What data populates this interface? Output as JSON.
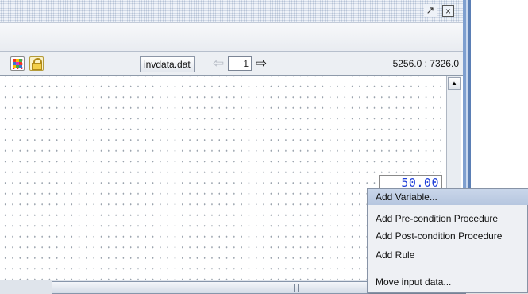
{
  "title_bar": {
    "detach_icon": "detach-window-icon",
    "close_icon": "close-icon"
  },
  "toolbar": {
    "grid_icon": "color-grid-icon",
    "lock_icon": "lock-icon",
    "file_name": "invdata.dat",
    "prev_icon": "arrow-left-icon",
    "page_number": "1",
    "next_icon": "arrow-right-icon",
    "coordinates": "5256.0 : 7326.0"
  },
  "canvas": {
    "value_box": "50.00"
  },
  "context_menu": {
    "items": [
      {
        "label": "Add Variable...",
        "highlighted": true
      },
      {
        "label": "Add Pre-condition Procedure",
        "highlighted": false
      },
      {
        "label": "Add Post-condition Procedure",
        "highlighted": false
      },
      {
        "label": "Add Rule",
        "highlighted": false
      },
      {
        "label": "Move input data...",
        "highlighted": false
      }
    ]
  },
  "colors": {
    "value_text": "#1f3fd8",
    "menu_highlight": "#c2d0e6",
    "window_border": "#5b7fb5"
  }
}
